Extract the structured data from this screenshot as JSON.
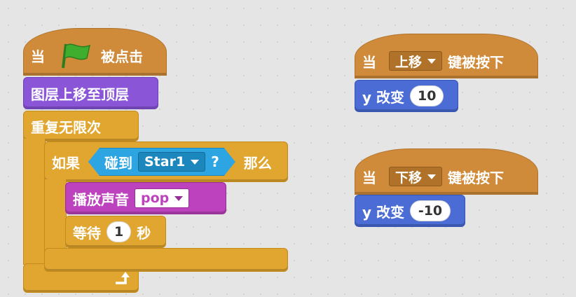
{
  "script1": {
    "hat": {
      "word_when": "当",
      "word_clicked": "被点击"
    },
    "front_layer": {
      "label": "图层上移至顶层"
    },
    "forever": {
      "label": "重复无限次"
    },
    "if": {
      "word_if": "如果",
      "word_then": "那么"
    },
    "touching": {
      "label": "碰到",
      "target": "Star1",
      "question": "?"
    },
    "play_sound": {
      "label": "播放声音",
      "sound": "pop"
    },
    "wait": {
      "label_prefix": "等待",
      "value": "1",
      "label_suffix": "秒"
    }
  },
  "script2": {
    "hat": {
      "word_when": "当",
      "key": "上移",
      "word_pressed": "键被按下"
    },
    "change_y": {
      "label": "y 改变",
      "value": "10"
    }
  },
  "script3": {
    "hat": {
      "word_when": "当",
      "key": "下移",
      "word_pressed": "键被按下"
    },
    "change_y": {
      "label": "y 改变",
      "value": "-10"
    }
  },
  "colors": {
    "events": "#cf8b3a",
    "looks": "#8a55d7",
    "sound": "#bd42bd",
    "control": "#e1a62f",
    "motion": "#4a6cd4",
    "sensing": "#2ca5e2",
    "flag": "#3fae2e"
  },
  "icons": {
    "flag": "green-flag-icon",
    "loop_arrow": "loop-arrow-icon"
  }
}
